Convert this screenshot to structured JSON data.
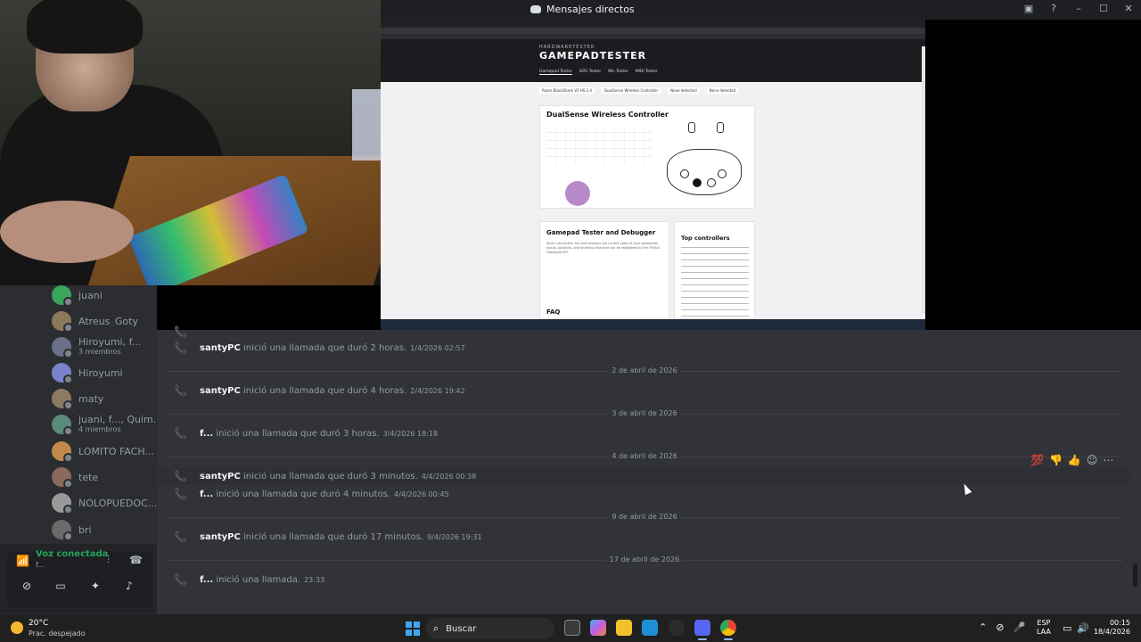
{
  "titlebar": {
    "title": "Mensajes directos"
  },
  "shared_screen": {
    "site_brand_small": "HARDWARETESTER",
    "site_brand": "GAMEPADTESTER",
    "nav": [
      "Gamepad Tester",
      "GPU Tester",
      "Mic Tester",
      "MIDI Tester"
    ],
    "tabs": [
      "Razer BlackShark V2 HS 2.4",
      "DualSense Wireless Controller",
      "None detected",
      "None detected"
    ],
    "controller_title": "DualSense Wireless Controller",
    "section_title": "Gamepad Tester and Debugger",
    "section_body": "When connected, this tool displays the current state of your gamepads, inputs, joysticks, and anything else that can be registered by the HTML5 Gamepad API.",
    "top_controllers": "Top controllers",
    "faq": "FAQ"
  },
  "dm_list": [
    {
      "name": "juani",
      "sub": "",
      "color": "#3ba55c"
    },
    {
      "name": "Atreus_Goty",
      "sub": "",
      "color": "#8a7a5a"
    },
    {
      "name": "Hiroyumi, f...",
      "sub": "3 miembros",
      "color": "#6a6f8a"
    },
    {
      "name": "Hiroyumi",
      "sub": "",
      "color": "#7a83c9"
    },
    {
      "name": "maty",
      "sub": "",
      "color": "#8c7a62"
    },
    {
      "name": "juani, f..., Quim...",
      "sub": "4 miembros",
      "color": "#5a8a7a"
    },
    {
      "name": "LOMITO FACH...",
      "sub": "",
      "color": "#c08a4a"
    },
    {
      "name": "tete",
      "sub": "",
      "color": "#8a6a5a"
    },
    {
      "name": "NOLOPUEDOC...",
      "sub": "",
      "color": "#9a9a9a"
    },
    {
      "name": "bri",
      "sub": "",
      "color": "#6a6a6a"
    }
  ],
  "voice": {
    "status": "Voz conectada",
    "channel": "f..."
  },
  "chat": {
    "messages": [
      {
        "who": "santyPC",
        "rest": "inició una llamada que duró 2 horas.",
        "ts": "1/4/2026 02:57"
      },
      {
        "who": "santyPC",
        "rest": "inició una llamada que duró 4 horas.",
        "ts": "2/4/2026 19:42"
      },
      {
        "who": "f...",
        "rest": "inició una llamada que duró 3 horas.",
        "ts": "3/4/2026 18:18"
      },
      {
        "who": "santyPC",
        "rest": "inició una llamada que duró 3 minutos.",
        "ts": "4/4/2026 00:38"
      },
      {
        "who": "f...",
        "rest": "inició una llamada que duró 4 minutos.",
        "ts": "4/4/2026 00:45"
      },
      {
        "who": "santyPC",
        "rest": "inició una llamada que duró 17 minutos.",
        "ts": "9/4/2026 19:31"
      },
      {
        "who": "f...",
        "rest": "inició una llamada.",
        "ts": "23:33"
      }
    ],
    "dividers": [
      "2 de abril de 2026",
      "3 de abril de 2026",
      "4 de abril de 2026",
      "9 de abril de 2026",
      "17 de abril de 2026"
    ]
  },
  "taskbar": {
    "temp": "20°C",
    "weather_desc": "Prac. despejado",
    "search_label": "Buscar",
    "lang_top": "ESP",
    "lang_bottom": "LAA",
    "time": "00:15",
    "date": "18/4/2026"
  }
}
